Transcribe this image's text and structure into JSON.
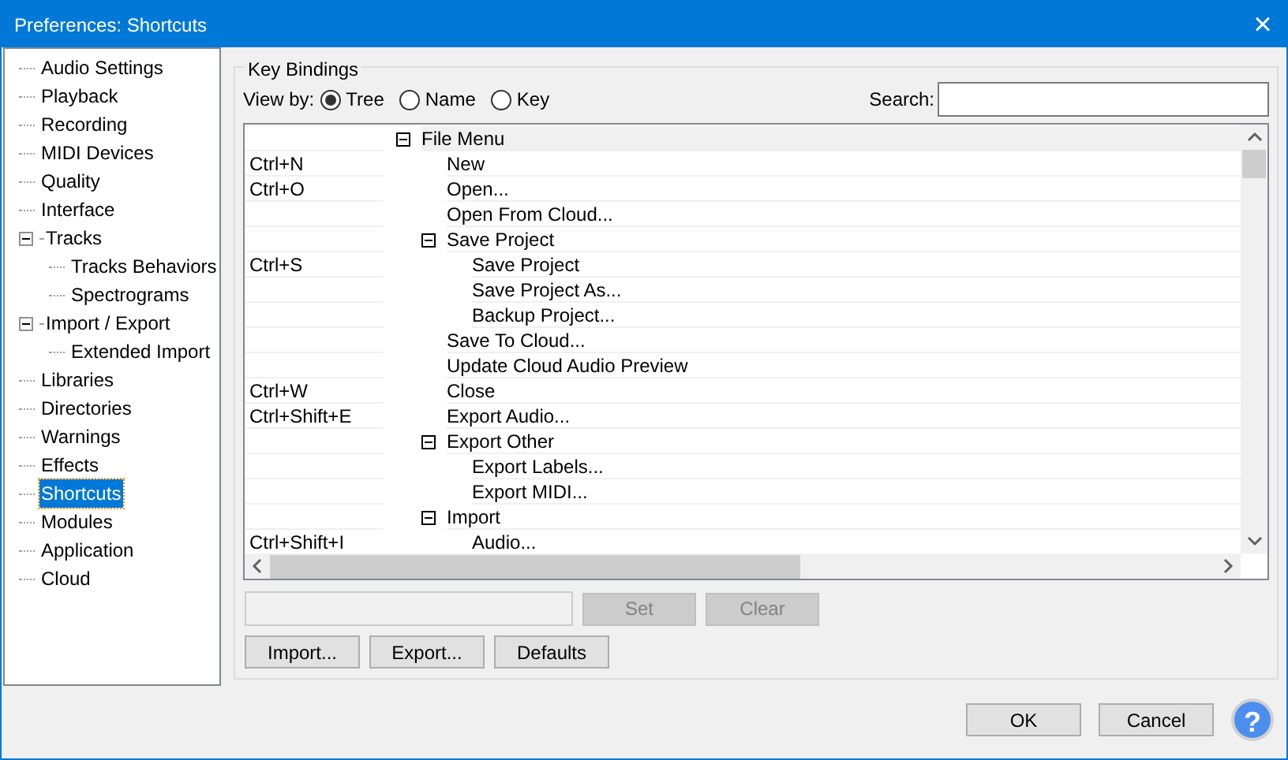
{
  "window": {
    "title": "Preferences: Shortcuts",
    "close": "×"
  },
  "sidebar": {
    "items": [
      {
        "label": "Audio Settings",
        "selected": false
      },
      {
        "label": "Playback",
        "selected": false
      },
      {
        "label": "Recording",
        "selected": false
      },
      {
        "label": "MIDI Devices",
        "selected": false
      },
      {
        "label": "Quality",
        "selected": false
      },
      {
        "label": "Interface",
        "selected": false
      },
      {
        "label": "Tracks",
        "selected": false,
        "expanded": true,
        "children": [
          {
            "label": "Tracks Behaviors",
            "selected": false
          },
          {
            "label": "Spectrograms",
            "selected": false
          }
        ]
      },
      {
        "label": "Import / Export",
        "selected": false,
        "expanded": true,
        "children": [
          {
            "label": "Extended Import",
            "selected": false
          }
        ]
      },
      {
        "label": "Libraries",
        "selected": false
      },
      {
        "label": "Directories",
        "selected": false
      },
      {
        "label": "Warnings",
        "selected": false
      },
      {
        "label": "Effects",
        "selected": false
      },
      {
        "label": "Shortcuts",
        "selected": true
      },
      {
        "label": "Modules",
        "selected": false
      },
      {
        "label": "Application",
        "selected": false
      },
      {
        "label": "Cloud",
        "selected": false
      }
    ]
  },
  "key_bindings": {
    "title": "Key Bindings",
    "view_by_label": "View by:",
    "view_options": [
      {
        "label": "Tree",
        "selected": true
      },
      {
        "label": "Name",
        "selected": false
      },
      {
        "label": "Key",
        "selected": false
      }
    ],
    "search_label": "Search:",
    "rows": [
      {
        "label": "File Menu",
        "expanded": true,
        "children": [
          {
            "label": "New",
            "key": "Ctrl+N"
          },
          {
            "label": "Open...",
            "key": "Ctrl+O"
          },
          {
            "label": "Open From Cloud..."
          },
          {
            "label": "Save Project",
            "expanded": true,
            "children": [
              {
                "label": "Save Project",
                "key": "Ctrl+S"
              },
              {
                "label": "Save Project As..."
              },
              {
                "label": "Backup Project..."
              }
            ]
          },
          {
            "label": "Save To Cloud..."
          },
          {
            "label": "Update Cloud Audio Preview"
          },
          {
            "label": "Close",
            "key": "Ctrl+W"
          },
          {
            "label": "Export Audio...",
            "key": "Ctrl+Shift+E"
          },
          {
            "label": "Export Other",
            "expanded": true,
            "children": [
              {
                "label": "Export Labels..."
              },
              {
                "label": "Export MIDI..."
              }
            ]
          },
          {
            "label": "Import",
            "expanded": true,
            "children": [
              {
                "label": "Audio...",
                "key": "Ctrl+Shift+I"
              }
            ]
          }
        ]
      }
    ],
    "set_button": {
      "label": "Set",
      "disabled": true
    },
    "clear_button": {
      "label": "Clear",
      "disabled": true
    },
    "buttons": [
      "Import...",
      "Export...",
      "Defaults"
    ]
  },
  "footer": {
    "buttons": [
      "OK",
      "Cancel"
    ],
    "help": "?"
  }
}
